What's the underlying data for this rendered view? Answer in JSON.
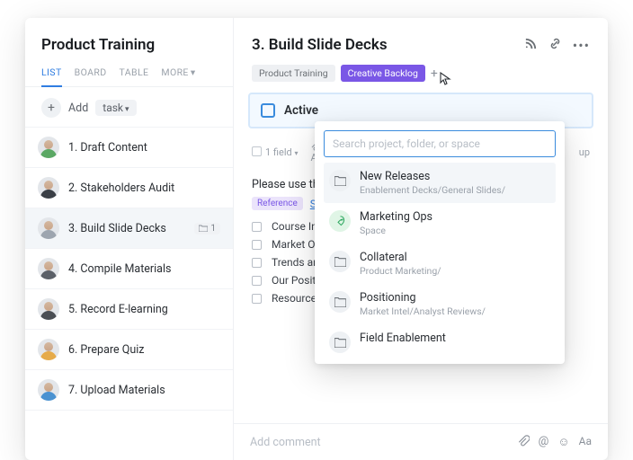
{
  "sidebar": {
    "title": "Product Training",
    "views": [
      "LIST",
      "BOARD",
      "TABLE",
      "MORE"
    ],
    "add_label": "Add",
    "task_label": "task",
    "tasks": [
      {
        "label": "1. Draft Content"
      },
      {
        "label": "2. Stakeholders Audit"
      },
      {
        "label": "3. Build Slide Decks",
        "selected": true,
        "folder_count": "1"
      },
      {
        "label": "4. Compile Materials"
      },
      {
        "label": "5. Record E-learning"
      },
      {
        "label": "6. Prepare Quiz"
      },
      {
        "label": "7. Upload Materials"
      }
    ]
  },
  "main": {
    "title": "3. Build Slide Decks",
    "tags": {
      "pt": "Product Training",
      "cb": "Creative Backlog"
    },
    "status": "Active",
    "field_text": "1 field",
    "add_approval": "Add approval",
    "setup": "up",
    "intro": "Please use this ten",
    "reference_label": "Reference",
    "reference_link": "Slide D",
    "bullets": [
      "Course Intro an",
      "Market Overvie",
      "Trends and Spe",
      "Our Positioning",
      "Resources and Contacts"
    ],
    "comment_placeholder": "Add comment"
  },
  "dropdown": {
    "search_placeholder": "Search project, folder, or space",
    "items": [
      {
        "name": "New Releases",
        "sub": "Enablement Decks/General Slides/",
        "icon": "folder",
        "hl": true
      },
      {
        "name": "Marketing Ops",
        "sub": "Space",
        "icon": "rocket"
      },
      {
        "name": "Collateral",
        "sub": "Product Marketing/",
        "icon": "folder"
      },
      {
        "name": "Positioning",
        "sub": "Market Intel/Analyst Reviews/",
        "icon": "folder"
      },
      {
        "name": "Field Enablement",
        "sub": "",
        "icon": "folder",
        "last": true
      }
    ]
  }
}
